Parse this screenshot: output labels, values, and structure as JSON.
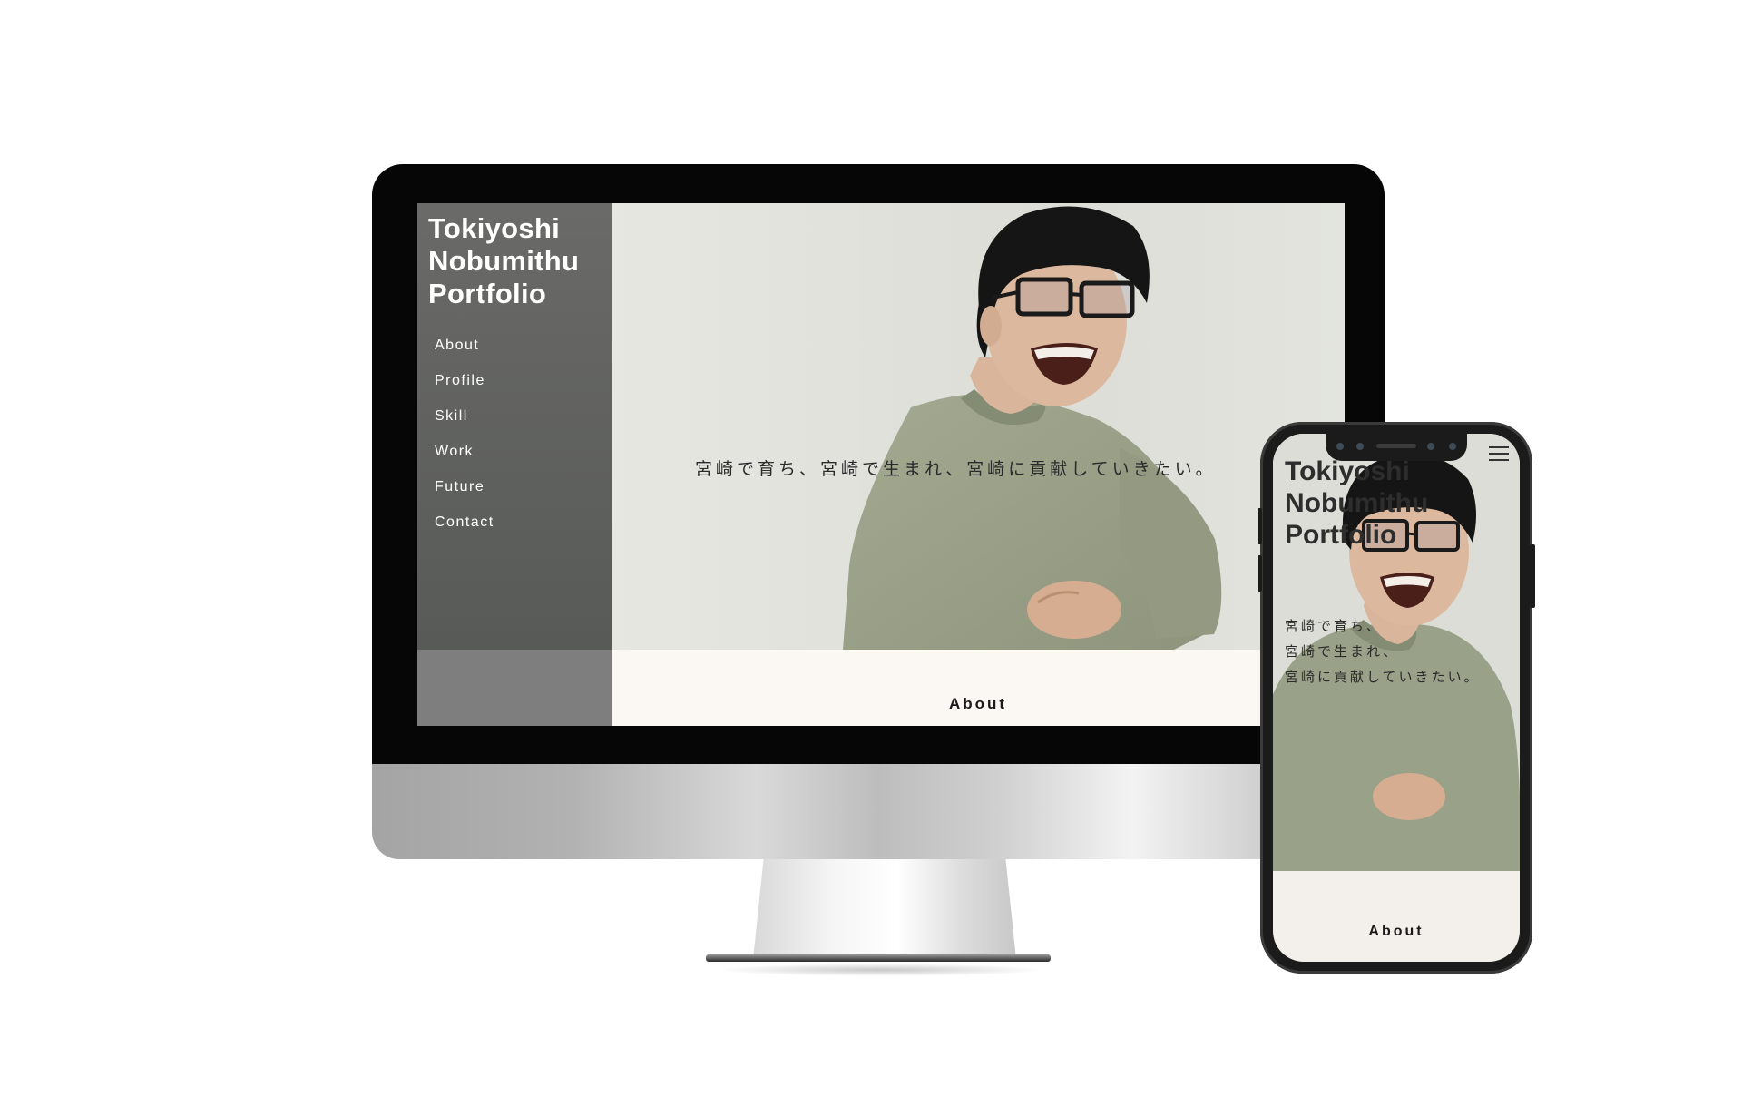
{
  "site": {
    "title_lines": [
      "Tokiyoshi",
      "Nobumithu",
      "Portfolio"
    ]
  },
  "nav": {
    "items": [
      {
        "label": "About"
      },
      {
        "label": "Profile"
      },
      {
        "label": "Skill"
      },
      {
        "label": "Work"
      },
      {
        "label": "Future"
      },
      {
        "label": "Contact"
      }
    ]
  },
  "hero": {
    "tagline": "宮崎で育ち、宮崎で生まれ、宮崎に貢献していきたい。"
  },
  "section": {
    "about_heading": "About"
  },
  "mobile": {
    "title_lines": [
      "Tokiyoshi",
      "Nobumithu",
      "Portfolio"
    ],
    "tagline_lines": [
      "宮崎で育ち、",
      "宮崎で生まれ、",
      "宮崎に貢献していきたい。"
    ],
    "about_heading": "About",
    "menu_icon": "hamburger-menu-icon"
  },
  "colors": {
    "sidebar": "#5f605e",
    "sidebar_bottom": "#7e7e7e",
    "about_band": "#fbf7f2",
    "device_bezel": "#060606",
    "shirt": "#9ba289"
  }
}
